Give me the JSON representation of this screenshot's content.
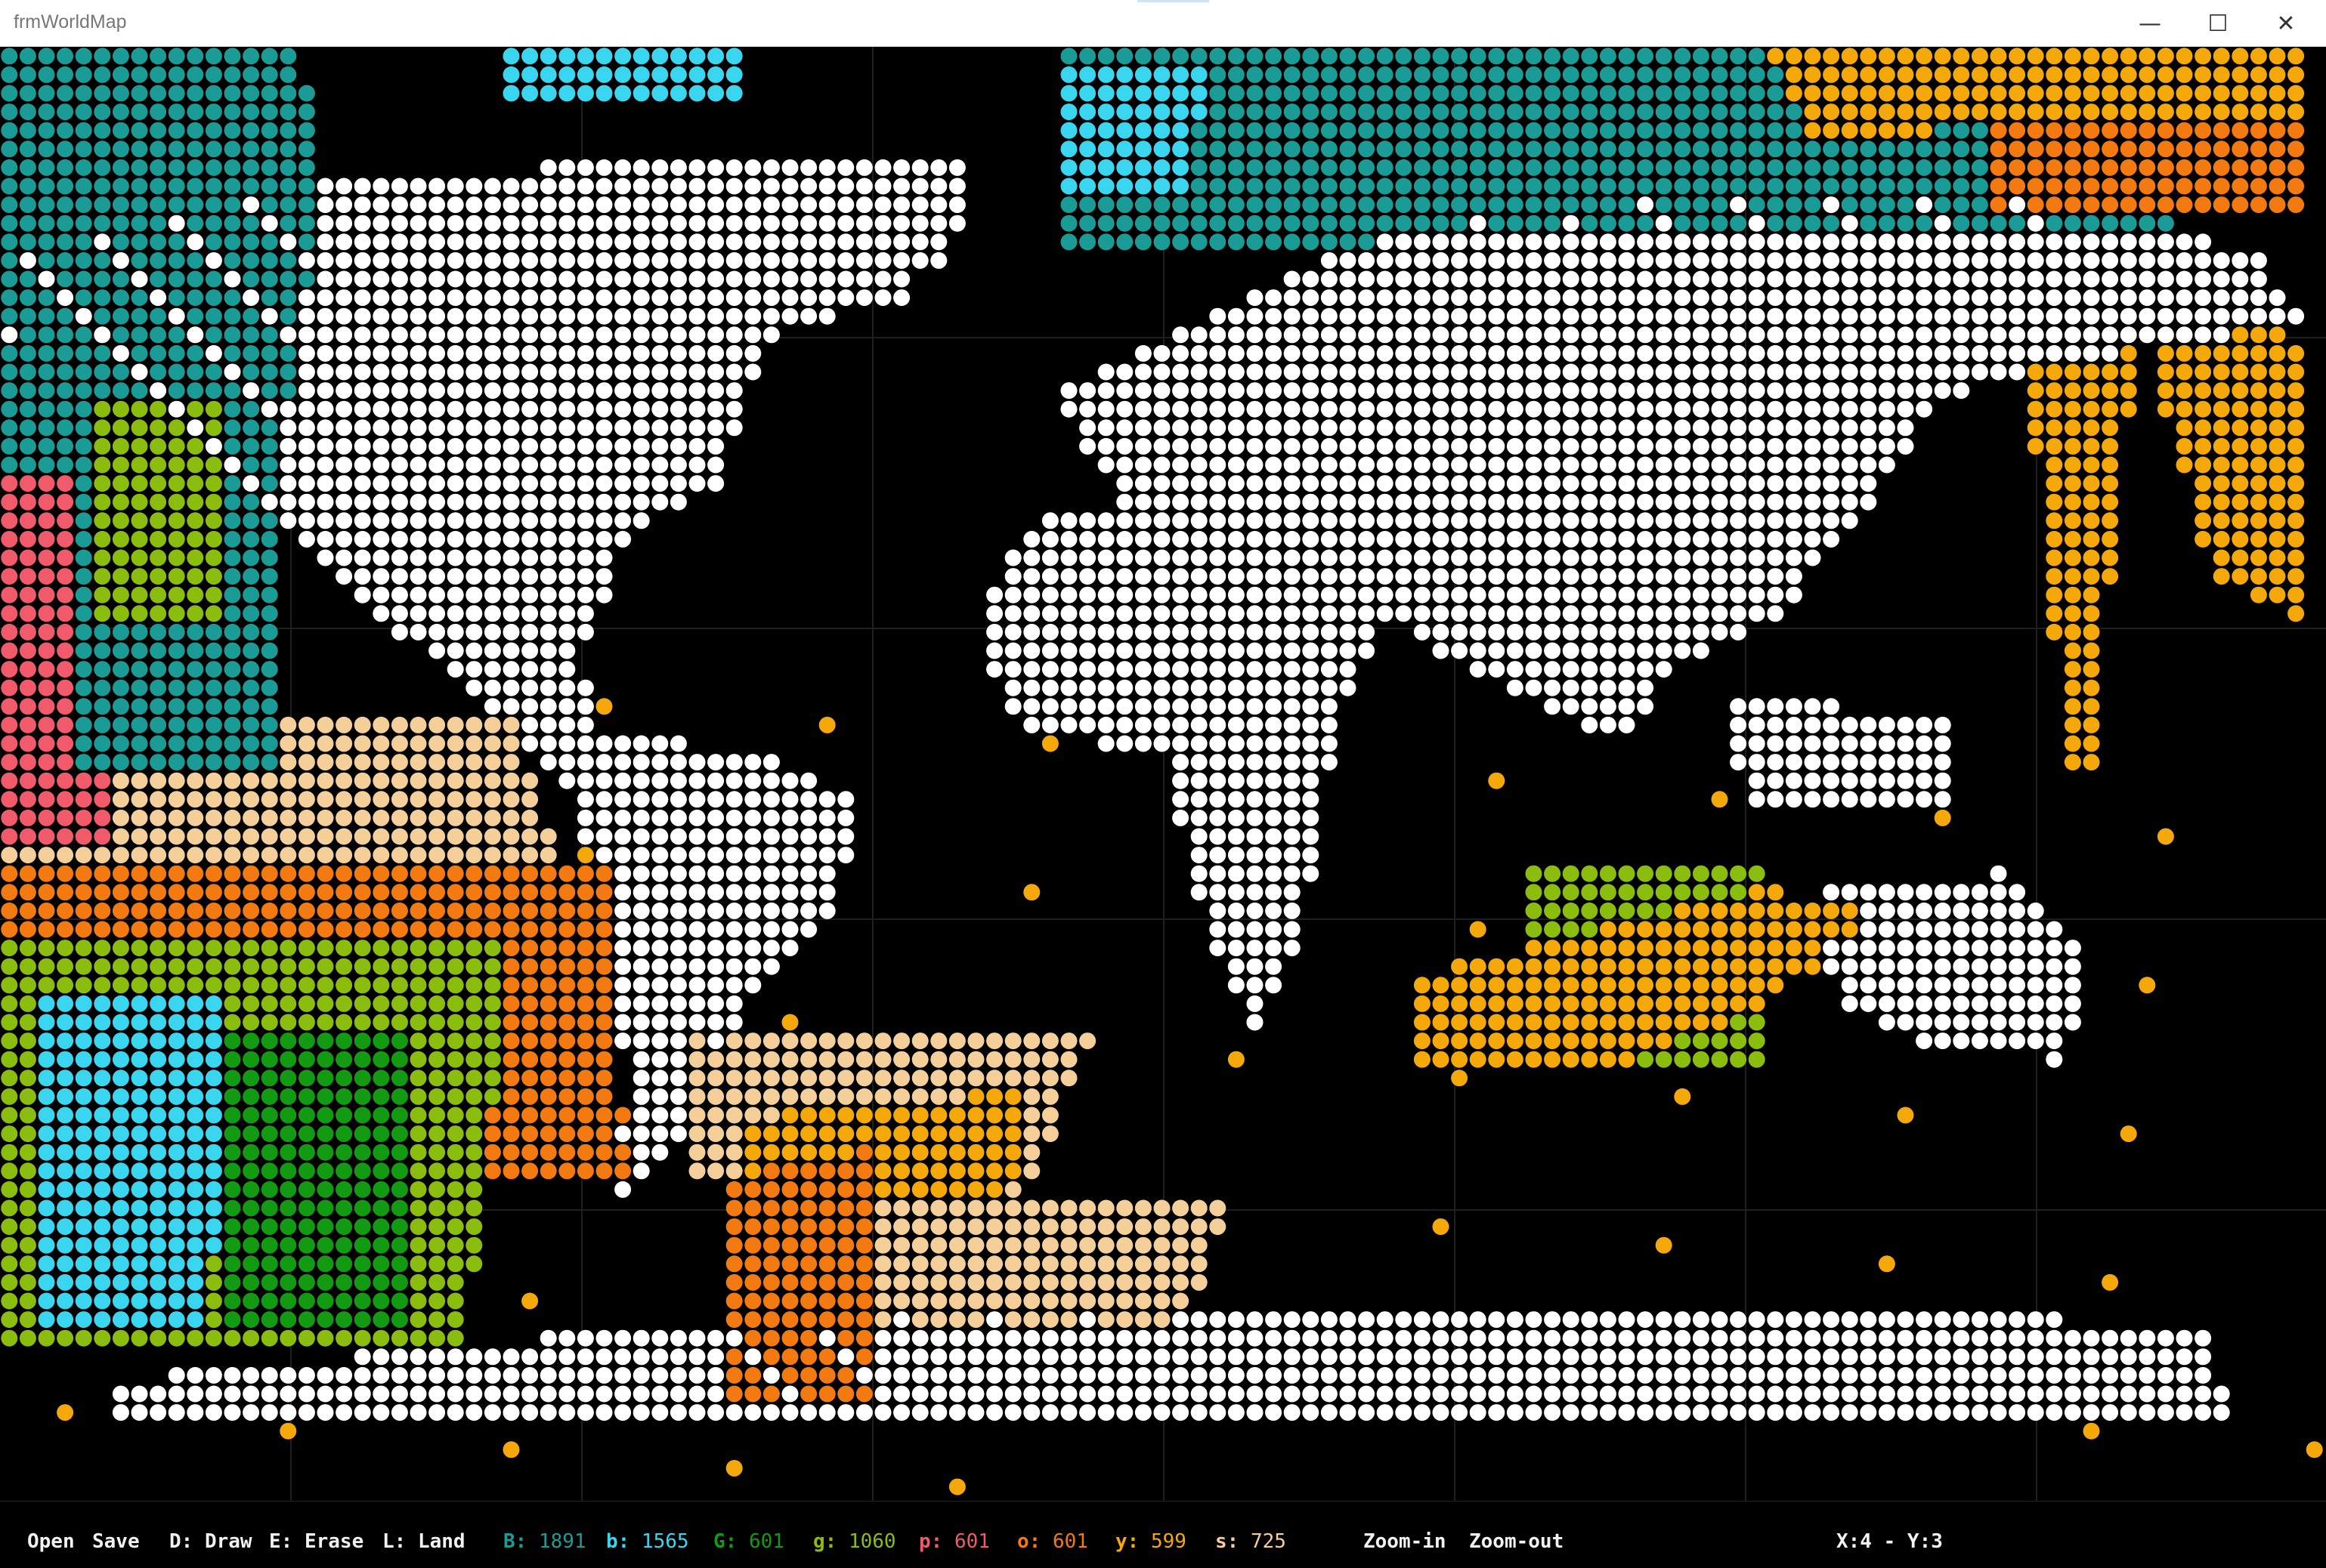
{
  "window": {
    "title": "frmWorldMap",
    "controls": {
      "minimize": "—",
      "maximize": "☐",
      "close": "✕"
    }
  },
  "toolbar": {
    "open": "Open",
    "save": "Save",
    "draw": "D: Draw",
    "erase": "E: Erase",
    "land": "L: Land",
    "zoom_in": "Zoom-in",
    "zoom_out": "Zoom-out",
    "coords": "X:4 - Y:3"
  },
  "counters": [
    {
      "key": "B:",
      "value": "1891",
      "color": "#1a9b96"
    },
    {
      "key": "b:",
      "value": "1565",
      "color": "#3ad6f0"
    },
    {
      "key": "G:",
      "value": "601",
      "color": "#129a12"
    },
    {
      "key": "g:",
      "value": "1060",
      "color": "#8bbd0f"
    },
    {
      "key": "p:",
      "value": "601",
      "color": "#f05a6a"
    },
    {
      "key": "o:",
      "value": "601",
      "color": "#f27a10"
    },
    {
      "key": "y:",
      "value": "599",
      "color": "#f5a80a"
    },
    {
      "key": "s:",
      "value": "725",
      "color": "#f5cf9a"
    }
  ],
  "palette": {
    "land": "#ffffff",
    "coast": "#0e2140",
    "B": "#1a9b96",
    "b": "#3ad6f0",
    "G": "#129a12",
    "g": "#8bbd0f",
    "p": "#f05a6a",
    "o": "#f27a10",
    "y": "#f5a80a",
    "s": "#f5cf9a"
  }
}
